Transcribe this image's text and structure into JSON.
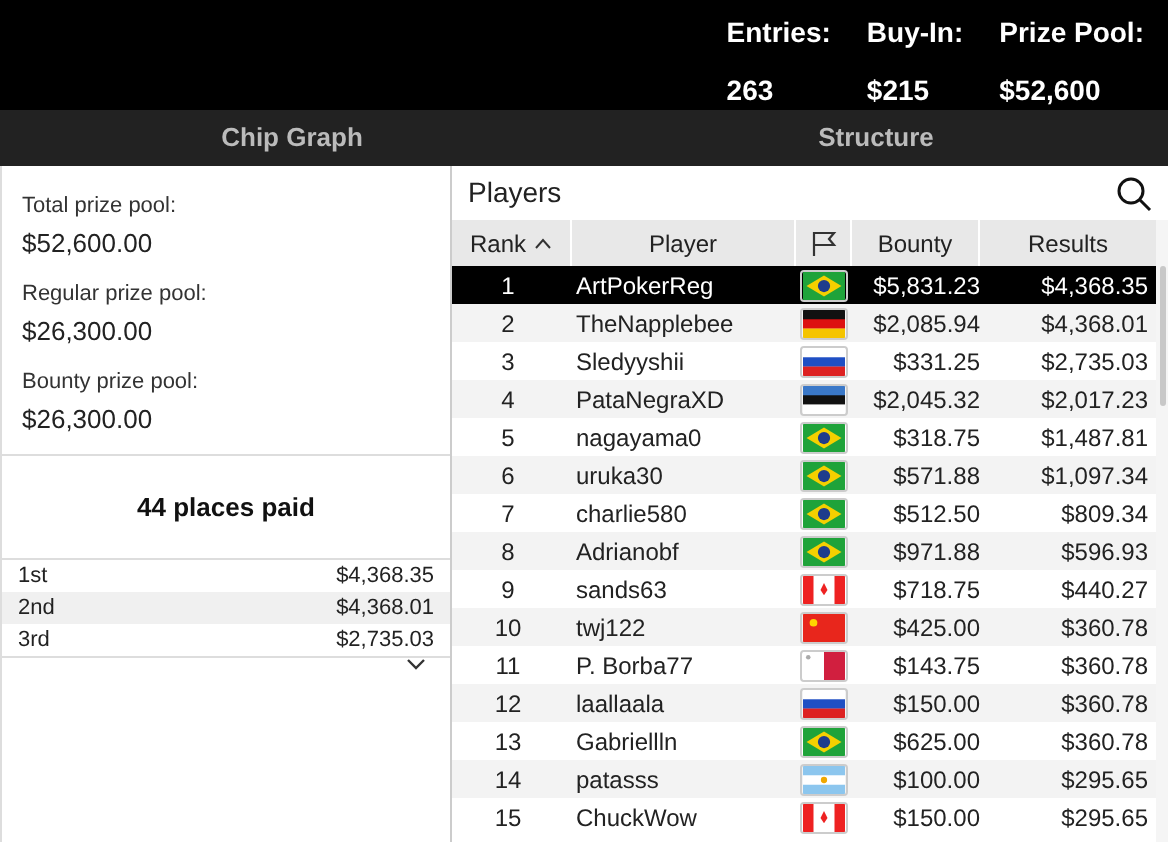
{
  "header": {
    "stats": [
      {
        "label": "Entries:",
        "value": "263"
      },
      {
        "label": "Buy-In:",
        "value": "$215"
      },
      {
        "label": "Prize Pool:",
        "value": "$52,600"
      }
    ]
  },
  "tabs": [
    {
      "label": "Chip Graph",
      "selected": false
    },
    {
      "label": "Structure",
      "selected": false
    }
  ],
  "prize_pools": [
    {
      "label": "Total prize pool:",
      "value": "$52,600.00"
    },
    {
      "label": "Regular prize pool:",
      "value": "$26,300.00"
    },
    {
      "label": "Bounty prize pool:",
      "value": "$26,300.00"
    }
  ],
  "places_paid": "44 places paid",
  "payouts": [
    {
      "place": "1st",
      "amount": "$4,368.35"
    },
    {
      "place": "2nd",
      "amount": "$4,368.01"
    },
    {
      "place": "3rd",
      "amount": "$2,735.03"
    }
  ],
  "players": {
    "title": "Players",
    "columns": [
      "Rank",
      "Player",
      "Bounty",
      "Results"
    ],
    "rows": [
      {
        "rank": "1",
        "player": "ArtPokerReg",
        "flag": {
          "kind": "br"
        },
        "bounty": "$5,831.23",
        "results": "$4,368.35",
        "selected": true
      },
      {
        "rank": "2",
        "player": "TheNapplebee",
        "flag": {
          "kind": "de"
        },
        "bounty": "$2,085.94",
        "results": "$4,368.01",
        "selected": false
      },
      {
        "rank": "3",
        "player": "Sledyyshii",
        "flag": {
          "kind": "ru"
        },
        "bounty": "$331.25",
        "results": "$2,735.03",
        "selected": false
      },
      {
        "rank": "4",
        "player": "PataNegraXD",
        "flag": {
          "kind": "ee"
        },
        "bounty": "$2,045.32",
        "results": "$2,017.23",
        "selected": false
      },
      {
        "rank": "5",
        "player": "nagayama0",
        "flag": {
          "kind": "br"
        },
        "bounty": "$318.75",
        "results": "$1,487.81",
        "selected": false
      },
      {
        "rank": "6",
        "player": "uruka30",
        "flag": {
          "kind": "br"
        },
        "bounty": "$571.88",
        "results": "$1,097.34",
        "selected": false
      },
      {
        "rank": "7",
        "player": "charlie580",
        "flag": {
          "kind": "br"
        },
        "bounty": "$512.50",
        "results": "$809.34",
        "selected": false
      },
      {
        "rank": "8",
        "player": "Adrianobf",
        "flag": {
          "kind": "br"
        },
        "bounty": "$971.88",
        "results": "$596.93",
        "selected": false
      },
      {
        "rank": "9",
        "player": "sands63",
        "flag": {
          "kind": "ca"
        },
        "bounty": "$718.75",
        "results": "$440.27",
        "selected": false
      },
      {
        "rank": "10",
        "player": "twj122",
        "flag": {
          "kind": "cn"
        },
        "bounty": "$425.00",
        "results": "$360.78",
        "selected": false
      },
      {
        "rank": "11",
        "player": "P. Borba77",
        "flag": {
          "kind": "mt"
        },
        "bounty": "$143.75",
        "results": "$360.78",
        "selected": false
      },
      {
        "rank": "12",
        "player": "laallaala",
        "flag": {
          "kind": "ru"
        },
        "bounty": "$150.00",
        "results": "$360.78",
        "selected": false
      },
      {
        "rank": "13",
        "player": "Gabriellln",
        "flag": {
          "kind": "br"
        },
        "bounty": "$625.00",
        "results": "$360.78",
        "selected": false
      },
      {
        "rank": "14",
        "player": "patasss",
        "flag": {
          "kind": "ar"
        },
        "bounty": "$100.00",
        "results": "$295.65",
        "selected": false
      },
      {
        "rank": "15",
        "player": "ChuckWow",
        "flag": {
          "kind": "ca"
        },
        "bounty": "$150.00",
        "results": "$295.65",
        "selected": false
      }
    ]
  }
}
